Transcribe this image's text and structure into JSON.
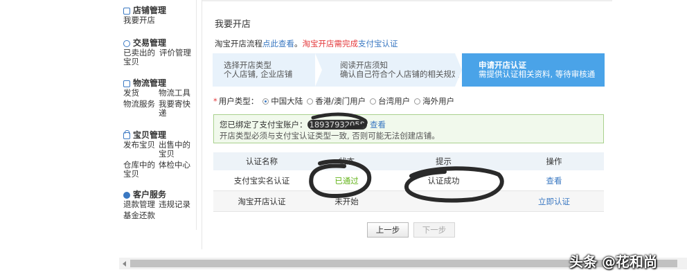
{
  "sidebar": {
    "sections": [
      {
        "icon": "store-icon",
        "title": "店铺管理",
        "links": [
          "我要开店"
        ]
      },
      {
        "icon": "trade-icon",
        "title": "交易管理",
        "links": [
          "已卖出的宝贝",
          "评价管理"
        ]
      },
      {
        "icon": "logistics-icon",
        "title": "物流管理",
        "links": [
          "发货",
          "物流工具",
          "物流服务",
          "我要寄快递"
        ]
      },
      {
        "icon": "lock-icon",
        "title": "宝贝管理",
        "links": [
          "发布宝贝",
          "出售中的宝贝",
          "仓库中的宝贝",
          "体检中心"
        ]
      },
      {
        "icon": "chat-icon",
        "title": "客户服务",
        "links": [
          "退款管理",
          "违规记录",
          "基金还款"
        ]
      }
    ]
  },
  "main": {
    "title": "我要开店",
    "notice": {
      "prefix": "淘宝开店流程",
      "link1": "点此查看",
      "sep": "。",
      "red": "淘宝开店需完成",
      "link2": "支付宝认证"
    },
    "steps": [
      {
        "title": "选择开店类型",
        "desc": "个人店铺, 企业店铺"
      },
      {
        "title": "阅读开店须知",
        "desc": "确认自己符合个人店铺的相关规定"
      },
      {
        "title": "申请开店认证",
        "desc": "需提供认证相关资料, 等待审核通"
      }
    ],
    "user_type": {
      "label": "用户类型：",
      "options": [
        "中国大陆",
        "香港/澳门用户",
        "台湾用户",
        "海外用户"
      ],
      "selected": "中国大陆"
    },
    "alipay": {
      "line1_prefix": "您已绑定了支付宝账户：",
      "account": "18937932058",
      "view": "查看",
      "line2": "开店类型必须与支付宝认证类型一致, 否则可能无法创建店铺。"
    },
    "table": {
      "headers": [
        "认证名称",
        "状态",
        "提示",
        "操作"
      ],
      "rows": [
        {
          "name": "支付宝实名认证",
          "status": "已通过",
          "tip": "认证成功",
          "action": "查看"
        },
        {
          "name": "淘宝开店认证",
          "status": "未开始",
          "tip": "",
          "action": "立即认证"
        }
      ]
    },
    "buttons": {
      "prev": "上一步",
      "next": "下一步"
    }
  },
  "colors": {
    "accent": "#3a78c2",
    "active_step": "#4aa3e8",
    "success": "#63b319",
    "warning": "#e4393c"
  },
  "watermark": "头条 @花和尚"
}
